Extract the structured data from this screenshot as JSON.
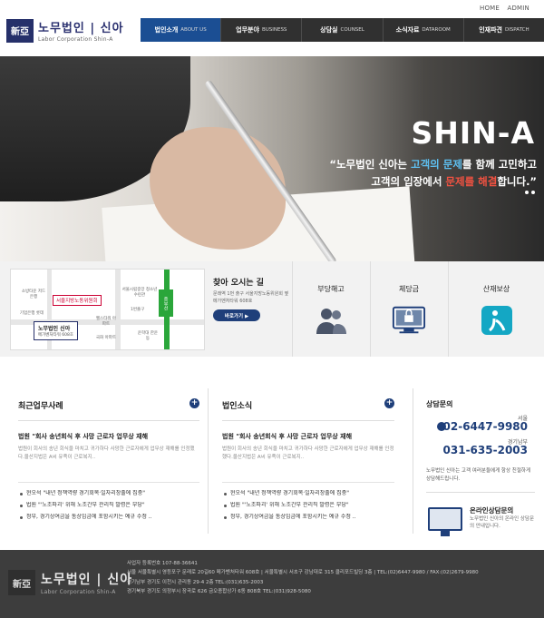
{
  "header": {
    "utility": [
      "HOME",
      "ADMIN"
    ],
    "logo_mark": "新亞",
    "logo_main": "노무법인 | 신아",
    "logo_sub": "Labor Corporation  Shin-A"
  },
  "nav": [
    {
      "ko": "법인소개",
      "en": "ABOUT US"
    },
    {
      "ko": "업무분야",
      "en": "BUSINESS"
    },
    {
      "ko": "상담실",
      "en": "COUNSEL"
    },
    {
      "ko": "소식자료",
      "en": "DATAROOM"
    },
    {
      "ko": "인재파견",
      "en": "DISPATCH"
    }
  ],
  "hero": {
    "title": "SHIN-A",
    "line1_a": "“노무법인 신아는 ",
    "line1_hl": "고객의 문제",
    "line1_b": "를 함께 고민하고",
    "line2_a": "고객의 입장에서 ",
    "line2_hl": "문제를 해결",
    "line2_b": "합니다.”"
  },
  "map": {
    "metro": "중부선",
    "labor_office": "서울지방노동위원회",
    "office_name": "노무법인 신아",
    "office_sub": "메가벤처타워 608호",
    "pois": [
      "소방타운 저드은행",
      "기업은행 롯데",
      "서울시립중앙 청소년수련관",
      "1번출구",
      "헬스타워 아파트",
      "국화 아파트",
      "운학대 한운동"
    ]
  },
  "visit": {
    "title": "찾아 오시는 길",
    "text": "문래역 1번 출구 서울지방노동위원회 옆 메가벤처타워 608호",
    "button": "바로가기 ▶"
  },
  "services": [
    {
      "label": "부당해고",
      "icon": "people-icon"
    },
    {
      "label": "체당금",
      "icon": "lock-screen-icon"
    },
    {
      "label": "산재보상",
      "icon": "injury-icon"
    }
  ],
  "recent_cases": {
    "title": "최근업무사례",
    "post_title": "법원 \"회사 송년회식 후 사망 근로자 업무상 재해",
    "post_body": "법원이 회사의 송년 회식을 마치고 귀가하다 사망한 근로자에게 업무상 재해를 인정했다.울산지법은 A씨 유족이 근로복지..",
    "bullets": [
      "현오석 \"내년 정책역량 경기회복·일자리창출에 집중\"",
      "법원 \"'노조파괴' 위해 노조간부 관리직 발령은 부당\"",
      "정부, 경기상여금을 통상임금에 포함시키는 예규 수정 .."
    ]
  },
  "firm_news": {
    "title": "법인소식",
    "post_title": "법원 \"회사 송년회식 후 사망 근로자 업무상 재해",
    "post_body": "법원이 회사의 송년 회식을 마치고 귀가하다 사망한 근로자에게 업무상 재해를 인정했다.울산지법은 A씨 유족이 근로복지..",
    "bullets": [
      "현오석 \"내년 정책역량 경기회복·일자리창출에 집중\"",
      "법원 \"'노조파괴' 위해 노조간부 관리직 발령은 부당\"",
      "정부, 경기상여금을 통상임금에 포함시키는 예규 수정 .."
    ]
  },
  "consult": {
    "title": "상담문의",
    "seoul_label": "서울",
    "seoul_phone": "02-6447-9980",
    "gyeonggi_label": "경기남부",
    "gyeonggi_phone": "031-635-2003",
    "desc": "노무법인 신아는 고객 여러분들에게 항상 친절하게 상담해드립니다.",
    "online_title": "온라인상담문의",
    "online_desc": "노무법인 신아의 온라인 상담문의 안내입니다."
  },
  "footer": {
    "line1": "사업자 등록번호 107-88-36641",
    "line2": "서울 서울특별시 영등포구 문래로 20길60 메가벤처타워 608호 | 서울특별시 서초구 강남대로 315 클리포드빌딩 3층 | TEL:(02)6447-9980 / FAX:(02)2679-9980",
    "line3": "경기남부 경기도 이천시 관리동 29-4 2층 TEL:(031)635-2003",
    "line4": "경기북부 경기도 의정부시 장곡로 626 금오종합상가 6동 808호 TEL:(031)928-5080"
  },
  "colors": {
    "nav_active": "#1b4e93",
    "navy": "#1f3f7a",
    "hero_blue": "#5ec0f1",
    "hero_red": "#f05241"
  }
}
